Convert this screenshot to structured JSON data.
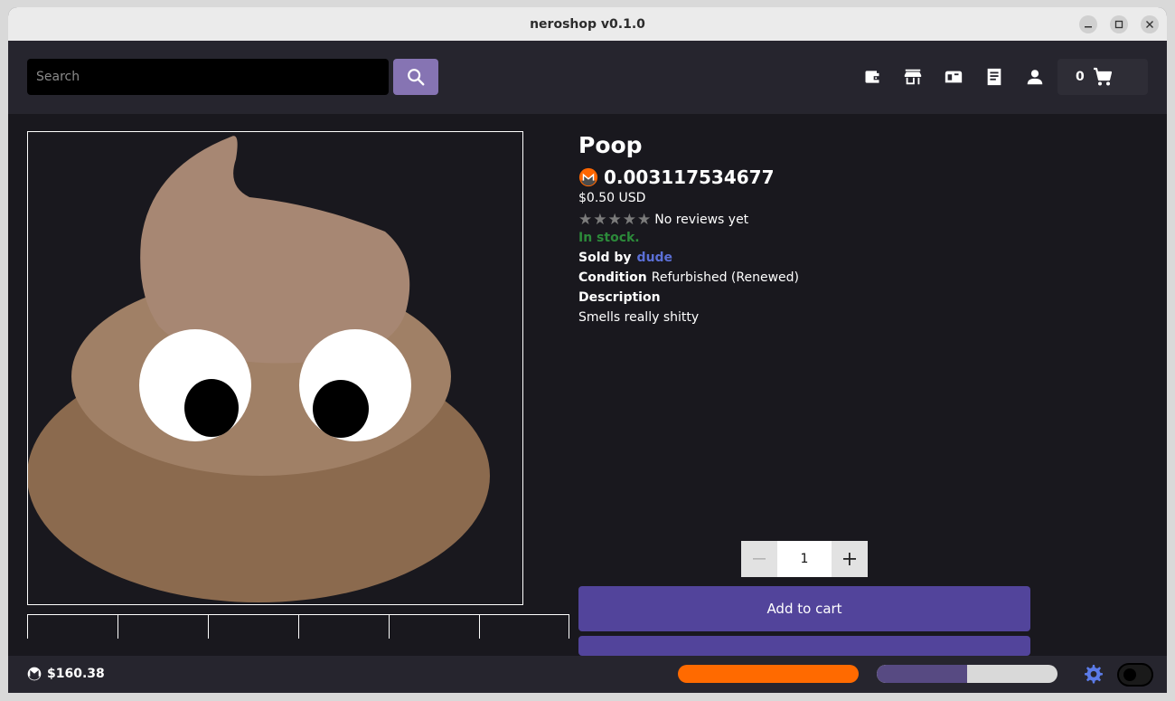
{
  "window": {
    "title": "neroshop v0.1.0"
  },
  "header": {
    "search_placeholder": "Search",
    "cart_count": "0"
  },
  "product": {
    "name": "Poop",
    "price_xmr": "0.003117534677",
    "price_usd": "$0.50 USD",
    "rating_stars": 0,
    "rating_text": "No reviews yet",
    "stock_status": "In stock.",
    "sold_by_label": "Sold by",
    "seller": "dude",
    "condition_label": "Condition",
    "condition": "Refurbished (Renewed)",
    "description_label": "Description",
    "description": "Smells really shitty",
    "quantity": "1",
    "add_to_cart_label": "Add to cart"
  },
  "footer": {
    "balance": "$160.38",
    "bar1_progress": 1.0,
    "bar2_progress": 0.5
  },
  "colors": {
    "accent": "#52449b",
    "search_button": "#8674b3",
    "stock_green": "#2c8a3a",
    "seller_link": "#5b6fd6",
    "orange_bar": "#ff6a00"
  },
  "icons": [
    "search-icon",
    "wallet-icon",
    "store-icon",
    "inbox-icon",
    "receipt-icon",
    "account-icon",
    "cart-icon",
    "monero-icon",
    "settings-icon"
  ]
}
